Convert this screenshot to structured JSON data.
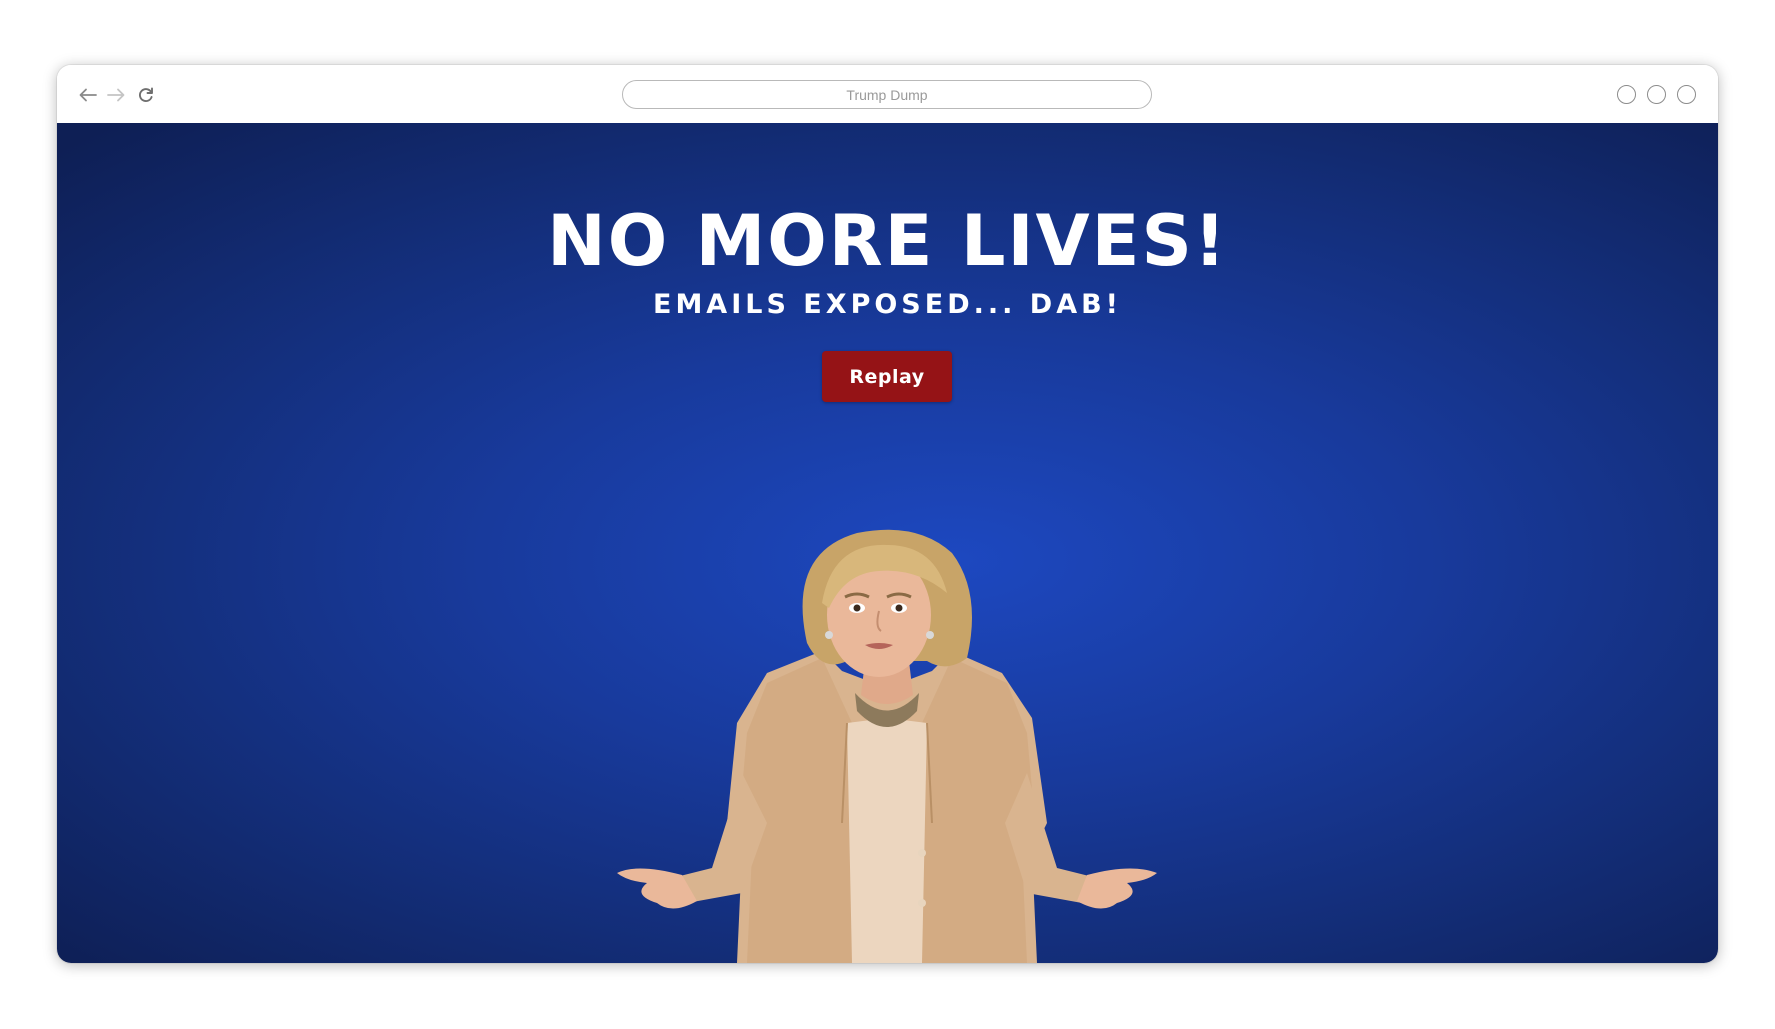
{
  "browser": {
    "address_text": "Trump Dump",
    "nav": {
      "back_icon": "arrow-left-icon",
      "forward_icon": "arrow-right-icon",
      "reload_icon": "reload-icon"
    },
    "window_controls": [
      "circle-control-icon",
      "circle-control-icon",
      "circle-control-icon"
    ]
  },
  "game": {
    "headline": "NO MORE LIVES!",
    "subhead": "EMAILS EXPOSED... DAB!",
    "replay_label": "Replay",
    "character_description": "shrugging-woman-figure"
  },
  "colors": {
    "background_center": "#1d48c0",
    "background_edge": "#0e1f55",
    "replay_button": "#951316",
    "text": "#ffffff"
  }
}
